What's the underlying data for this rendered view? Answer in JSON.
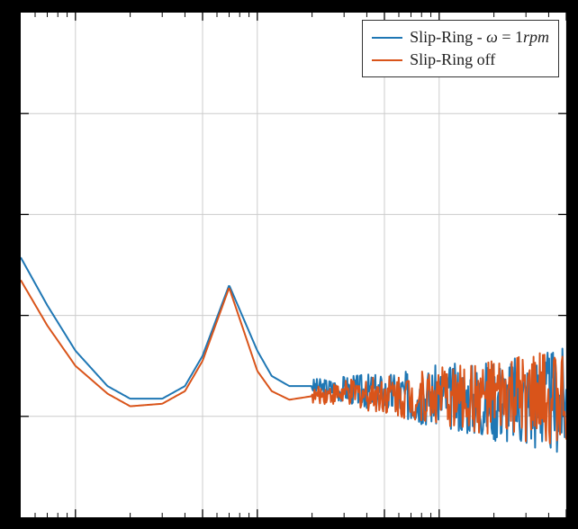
{
  "chart_data": {
    "type": "line",
    "x_scale": "log",
    "xlim": [
      0.5,
      500
    ],
    "ylim": [
      0,
      1.0
    ],
    "xlabel": "",
    "ylabel": "",
    "title": "",
    "grid": true,
    "legend_position": "upper right",
    "x": [
      0.5,
      0.7,
      1,
      1.5,
      2,
      3,
      4,
      5,
      7,
      10,
      12,
      15,
      20,
      25,
      30,
      40,
      50,
      70,
      100,
      150,
      200,
      300,
      400,
      500
    ],
    "series": [
      {
        "name": "Slip-Ring - ω = 1rpm",
        "color": "#1f77b4",
        "values": [
          0.515,
          0.42,
          0.33,
          0.26,
          0.235,
          0.235,
          0.26,
          0.32,
          0.46,
          0.33,
          0.28,
          0.26,
          0.26,
          0.255,
          0.255,
          0.25,
          0.245,
          0.24,
          0.24,
          0.235,
          0.235,
          0.23,
          0.23,
          0.23
        ],
        "noise_start_x": 20,
        "noise_amplitude_end": 0.11
      },
      {
        "name": "Slip-Ring off",
        "color": "#d9541a",
        "values": [
          0.47,
          0.38,
          0.3,
          0.245,
          0.22,
          0.225,
          0.25,
          0.31,
          0.455,
          0.29,
          0.25,
          0.233,
          0.24,
          0.245,
          0.245,
          0.245,
          0.245,
          0.24,
          0.24,
          0.235,
          0.235,
          0.235,
          0.235,
          0.235
        ],
        "noise_start_x": 20,
        "noise_amplitude_end": 0.1
      }
    ],
    "gridlines_x": [
      1,
      5,
      10,
      50,
      100,
      500
    ],
    "minor_ticks_x": [
      0.6,
      0.7,
      0.8,
      0.9,
      2,
      3,
      4,
      6,
      7,
      8,
      9,
      20,
      30,
      40,
      60,
      70,
      80,
      90,
      200,
      300,
      400
    ],
    "gridlines_y": [
      0.2,
      0.4,
      0.6,
      0.8
    ]
  },
  "legend": {
    "items": [
      {
        "label_html": "Slip-Ring - <i>ω</i> = 1<i>rpm</i>",
        "color": "#1f77b4"
      },
      {
        "label_html": "Slip-Ring off",
        "color": "#d9541a"
      }
    ]
  }
}
